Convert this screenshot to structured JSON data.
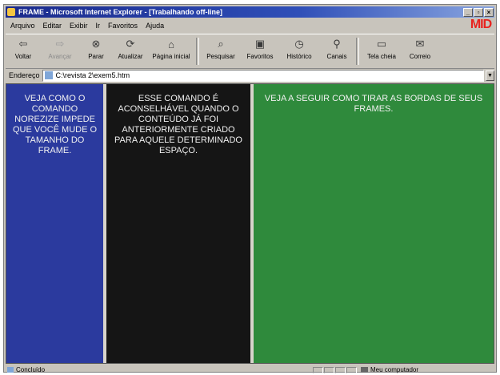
{
  "window": {
    "title": "FRAME - Microsoft Internet Explorer - [Trabalhando off-line]",
    "controls": [
      "_",
      "▫",
      "×"
    ]
  },
  "menu": {
    "items": [
      "Arquivo",
      "Editar",
      "Exibir",
      "Ir",
      "Favoritos",
      "Ajuda"
    ],
    "brand": "MID"
  },
  "toolbar": {
    "back": "Voltar",
    "forward": "Avançar",
    "stop": "Parar",
    "refresh": "Atualizar",
    "home": "Página inicial",
    "search": "Pesquisar",
    "favorites": "Favoritos",
    "history": "Histórico",
    "channels": "Canais",
    "fullscreen": "Tela cheia",
    "mail": "Correio"
  },
  "address": {
    "label": "Endereço",
    "value": "C:\\revista 2\\exem5.htm"
  },
  "frames": {
    "left": "VEJA COMO O COMANDO NOREZIZE IMPEDE QUE VOCÊ MUDE O TAMANHO DO FRAME.",
    "middle": "ESSE COMANDO É ACONSELHÁVEL QUANDO O CONTEÚDO JÁ FOI ANTERIORMENTE CRIADO PARA AQUELE DETERMINADO ESPAÇO.",
    "right": "VEJA A SEGUIR COMO TIRAR AS BORDAS DE SEUS FRAMES."
  },
  "status": {
    "text": "Concluído",
    "zone": "Meu computador"
  },
  "colors": {
    "frame_left": "#2b3a9e",
    "frame_middle": "#151515",
    "frame_right": "#2f8a3c"
  }
}
